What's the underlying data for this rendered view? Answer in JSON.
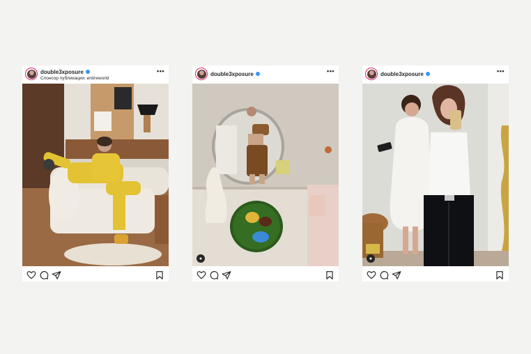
{
  "posts": [
    {
      "username": "double3xposure",
      "sponsor_line": "Спонсор публикации: entireworld",
      "more_label": "•••"
    },
    {
      "username": "double3xposure",
      "more_label": "•••"
    },
    {
      "username": "double3xposure",
      "more_label": "•••"
    }
  ],
  "icons": [
    "heart-icon",
    "comment-icon",
    "share-icon",
    "bookmark-icon",
    "user-tag-icon",
    "verified-badge-icon"
  ],
  "colors": {
    "background": "#f3f3f2",
    "card": "#ffffff",
    "text": "#262626",
    "verified": "#3897f0",
    "avatar_ring": "#d6246e"
  }
}
